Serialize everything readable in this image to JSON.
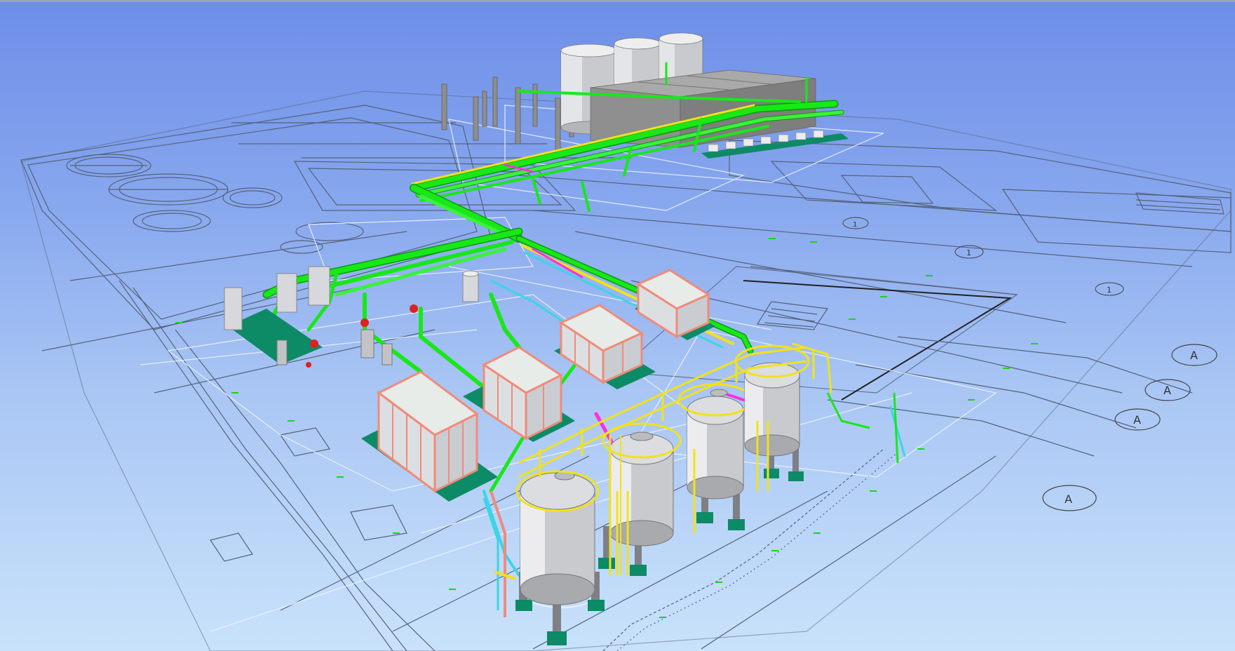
{
  "viewport": {
    "background_top": "#6d8ee8",
    "background_bottom": "#c9e2fb"
  },
  "colors": {
    "plan_lines": "#55627a",
    "plan_lines_light": "#eef4ff",
    "pipe_main": "#18e818",
    "pipe_main_dark": "#0b9a0b",
    "pipe_yellow": "#f2e21a",
    "pipe_cyan": "#3cd4e6",
    "pipe_magenta": "#ff2ee0",
    "frame_salmon": "#f08b7a",
    "skid_base": "#0d8a66",
    "vessel": "#d9dadd",
    "building": "#9a9a9a",
    "valve_red": "#e02020"
  },
  "grid_bubbles": [
    {
      "label": "A"
    },
    {
      "label": "A"
    },
    {
      "label": "A"
    },
    {
      "label": "A"
    },
    {
      "label": "1"
    },
    {
      "label": "1"
    },
    {
      "label": "1"
    }
  ]
}
